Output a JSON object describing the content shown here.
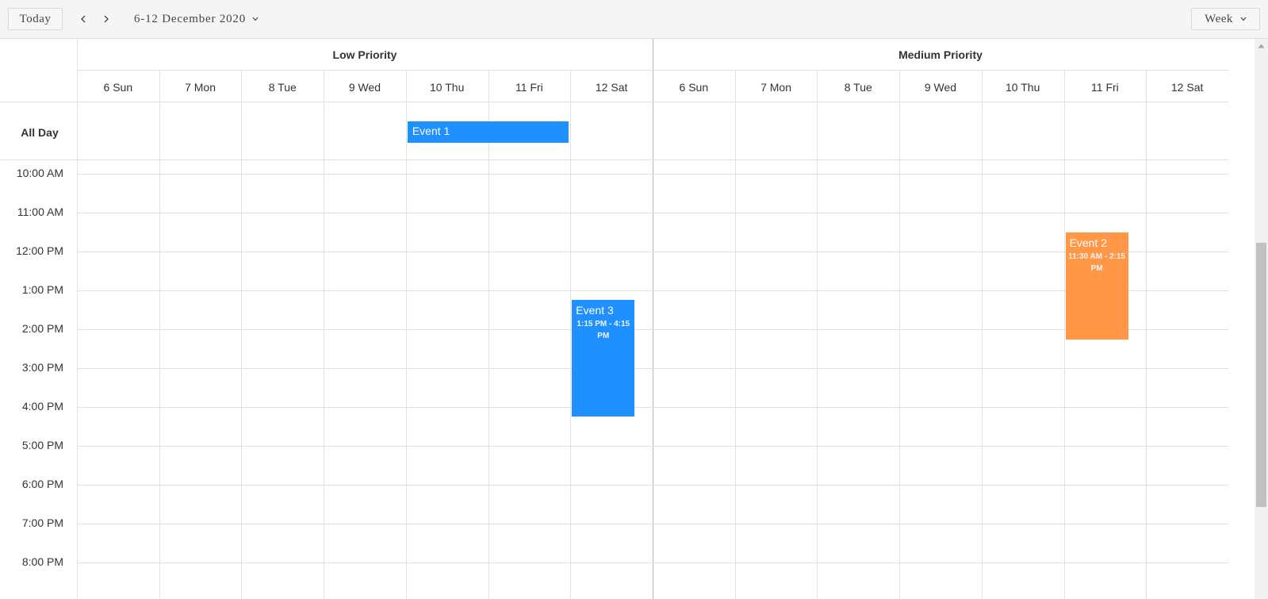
{
  "toolbar": {
    "today_label": "Today",
    "date_range": "6-12 December 2020",
    "view_label": "Week"
  },
  "groups": [
    {
      "name": "Low Priority"
    },
    {
      "name": "Medium Priority"
    }
  ],
  "days": [
    "6 Sun",
    "7 Mon",
    "8 Tue",
    "9 Wed",
    "10 Thu",
    "11 Fri",
    "12 Sat"
  ],
  "all_day_label": "All Day",
  "time_slots": [
    "10:00 AM",
    "11:00 AM",
    "12:00 PM",
    "1:00 PM",
    "2:00 PM",
    "3:00 PM",
    "4:00 PM",
    "5:00 PM",
    "6:00 PM",
    "7:00 PM",
    "8:00 PM"
  ],
  "events": [
    {
      "title": "Event 1",
      "all_day": true,
      "group": "Low Priority",
      "start_day": "10 Thu",
      "end_day": "11 Fri",
      "color": "#1e90ff"
    },
    {
      "title": "Event 2",
      "group": "Medium Priority",
      "day": "11 Fri",
      "start": "11:30 AM",
      "end": "2:15 PM",
      "time_text": "11:30 AM - 2:15 PM",
      "color": "#ff9747"
    },
    {
      "title": "Event 3",
      "group": "Low Priority",
      "day": "12 Sat",
      "start": "1:15 PM",
      "end": "4:15 PM",
      "time_text": "1:15 PM - 4:15 PM",
      "color": "#1e90ff"
    }
  ]
}
